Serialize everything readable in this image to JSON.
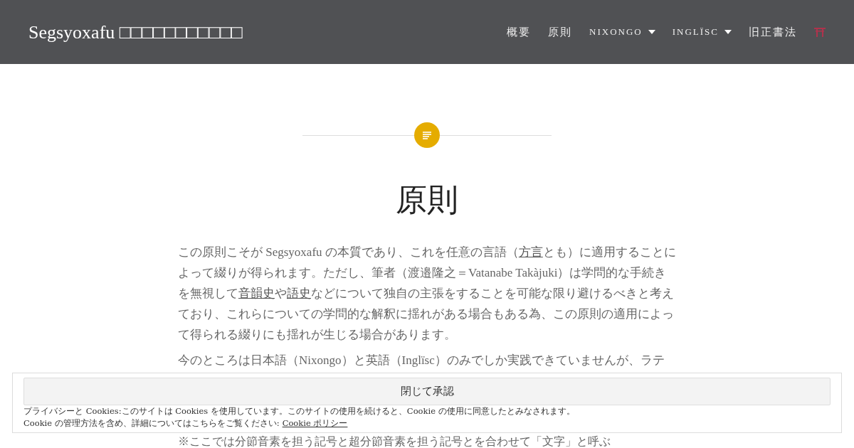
{
  "header": {
    "site_title": "Segsyoxafu □□□□□□□□□□□",
    "nav": [
      {
        "label": "概要",
        "kind": "link"
      },
      {
        "label": "原則",
        "kind": "link"
      },
      {
        "label": "NIXONGO",
        "kind": "dropdown"
      },
      {
        "label": "INGLÏSC",
        "kind": "dropdown"
      },
      {
        "label": "旧正書法",
        "kind": "link"
      },
      {
        "kind": "icon"
      }
    ]
  },
  "article": {
    "title": "原則",
    "paragraphs": [
      [
        {
          "text": "この原則こそが Segsyoxafu の本質であり、これを任意の言語（",
          "link": false
        },
        {
          "text": "方言",
          "link": true
        },
        {
          "text": "とも）に適用することによって綴りが得られます。ただし、筆者（渡邉隆之＝Vatanabe Takàjuki）は学問的な手続きを無視して",
          "link": false
        },
        {
          "text": "音韻史",
          "link": true
        },
        {
          "text": "や",
          "link": false
        },
        {
          "text": "語史",
          "link": true
        },
        {
          "text": "などについて独自の主張をすることを可能な限り避けるべきと考えており、これらについての学問的な解釈に揺れがある場合もある為、この原則の適用によって得られる綴りにも揺れが生じる場合があります。",
          "link": false
        }
      ],
      [
        {
          "text": "今のところは日本語（Nixongo）と英語（Inglïsc）のみでしか実践できていませんが、ラテ",
          "link": false
        }
      ],
      [
        {
          "text": "※ここでは分節音素を担う記号と超分節音素を担う記号とを合わせて「文字」と呼ぶ",
          "link": false
        }
      ]
    ]
  },
  "cookie_banner": {
    "button": "閉じて承認",
    "notice": "プライバシーと Cookies:このサイトは Cookies を使用しています。このサイトの使用を続けると、Cookie の使用に同意したとみなされます。",
    "more": "Cookie の管理方法を含め、詳細についてはこちらをご覧ください:",
    "link": "Cookie ポリシー"
  }
}
